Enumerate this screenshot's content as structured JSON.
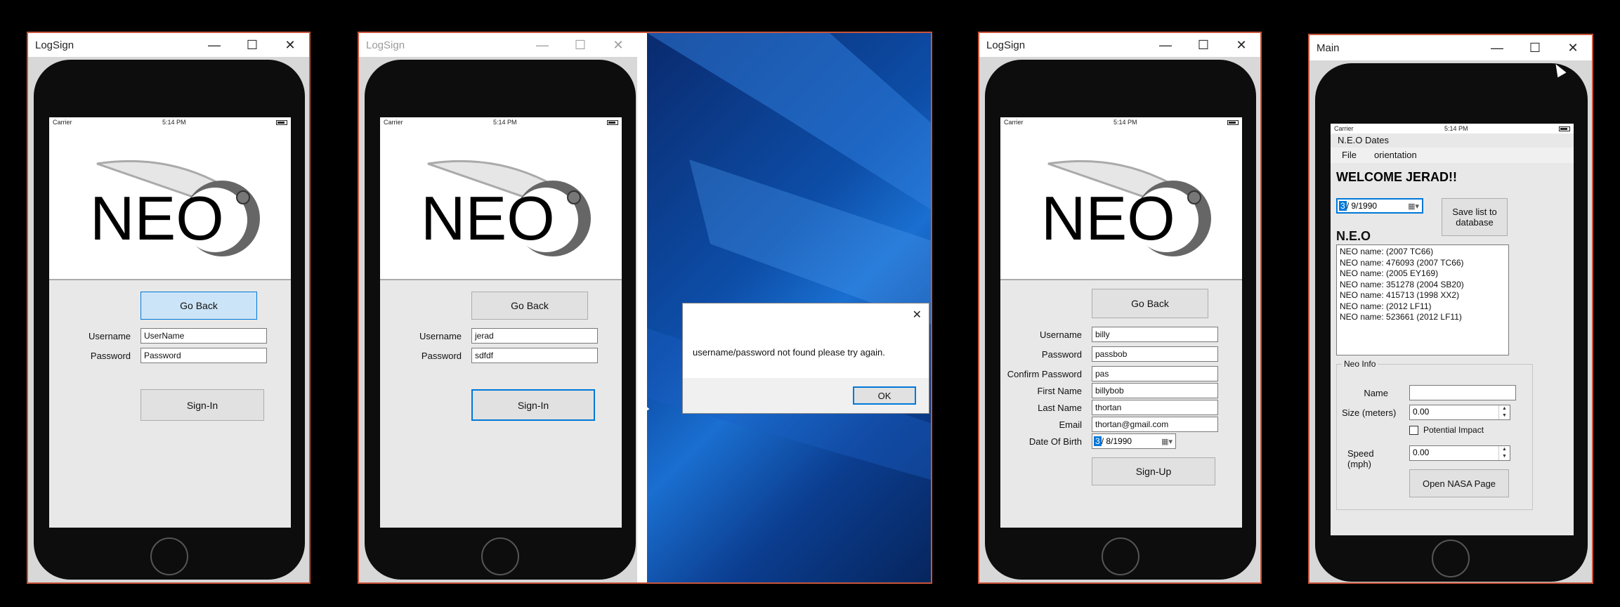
{
  "status": {
    "carrier": "Carrier",
    "time": "5:14 PM"
  },
  "logo_text": "NEO",
  "win1": {
    "title": "LogSign",
    "go_back": "Go Back",
    "username_label": "Username",
    "password_label": "Password",
    "username_value": "UserName",
    "password_value": "Password",
    "sign_in": "Sign-In"
  },
  "win2": {
    "title": "LogSign",
    "go_back": "Go Back",
    "username_label": "Username",
    "password_label": "Password",
    "username_value": "jerad",
    "password_value": "sdfdf",
    "sign_in": "Sign-In",
    "dialog_message": "username/password not found please try again.",
    "dialog_ok": "OK"
  },
  "win3": {
    "title": "LogSign",
    "go_back": "Go Back",
    "fields": [
      {
        "label": "Username",
        "value": "billy"
      },
      {
        "label": "Password",
        "value": "passbob"
      },
      {
        "label": "Confirm Password",
        "value": "pas"
      },
      {
        "label": "First Name",
        "value": "billybob"
      },
      {
        "label": "Last Name",
        "value": "thortan"
      },
      {
        "label": "Email",
        "value": "thortan@gmail.com"
      }
    ],
    "dob_label": "Date Of Birth",
    "dob_month": "3",
    "dob_rest": "/ 8/1990",
    "sign_up": "Sign-Up"
  },
  "win4": {
    "title": "Main",
    "form_title": "N.E.O Dates",
    "menu": [
      "File",
      "orientation"
    ],
    "welcome": "WELCOME JERAD!!",
    "date_month": "3",
    "date_rest": "/ 9/1990",
    "save_button": "Save list to database",
    "neo_heading": "N.E.O",
    "neo_list": [
      "NEO name: (2007 TC66)",
      "NEO name: 476093 (2007 TC66)",
      "NEO name: (2005 EY169)",
      "NEO name: 351278 (2004 SB20)",
      "NEO name: 415713 (1998 XX2)",
      "NEO name: (2012 LF11)",
      "NEO name: 523661 (2012 LF11)"
    ],
    "neo_info_title": "Neo Info",
    "name_label": "Name",
    "size_label": "Size (meters)",
    "size_value": "0.00",
    "impact_label": "Potential Impact",
    "speed_label": "Speed (mph)",
    "speed_value": "0.00",
    "nasa_button": "Open NASA Page"
  },
  "colors": {
    "accent": "#0078d7",
    "window_border": "#c8553a"
  }
}
